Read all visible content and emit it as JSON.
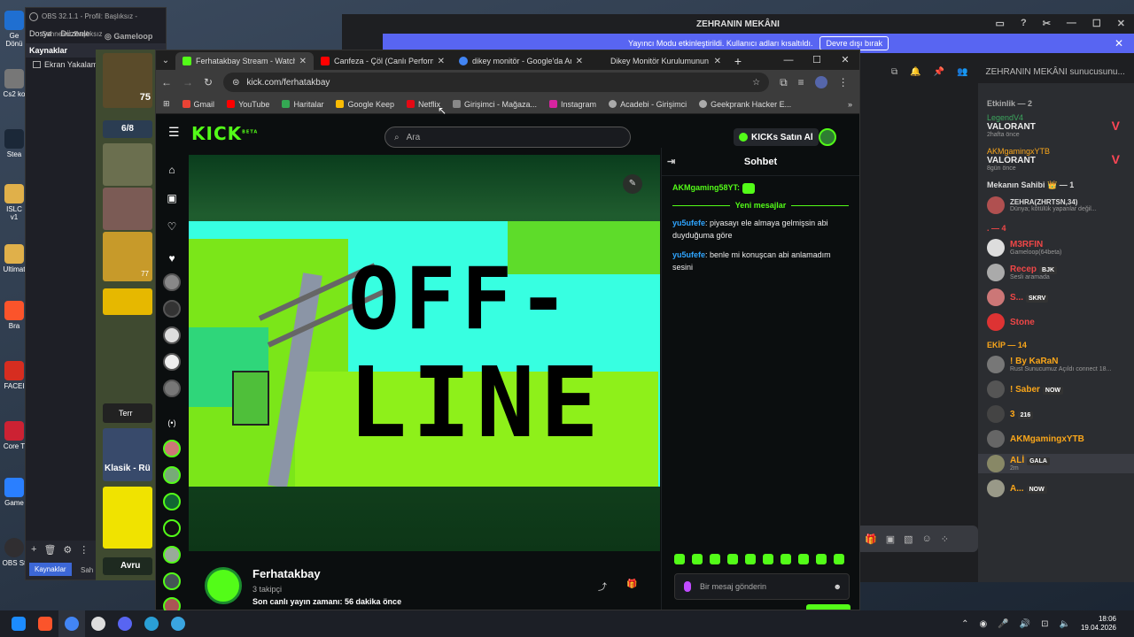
{
  "desktop": {
    "icons": [
      "Ge Dönü",
      "Cs2 ko",
      "Stea",
      "ISLC v1",
      "Ultimat",
      "Bra",
      "FACEI",
      "Core T",
      "Game",
      "OBS St"
    ]
  },
  "obs": {
    "title": "OBS 32.1.1 - Profil: Başlıksız - Sahneler: Başlıksız",
    "menu": [
      "Dosya",
      "Düzenle"
    ],
    "panel_title": "Kaynaklar",
    "source": "Ekran Yakalam",
    "tab_active": "Kaynaklar",
    "tab_other": "Sah"
  },
  "gameloop": {
    "label": "Gameloop"
  },
  "gamestrip": {
    "badge": "6/8",
    "level": "75",
    "card_num": "77",
    "terr": "Terr",
    "mode": "Klasik - Rü",
    "avru": "Avru"
  },
  "discord": {
    "server_title": "ZEHRANIN MEKÂNI",
    "banner_text": "Yayıncı Modu etkinleştirildi. Kullanıcı adları kısaltıldı.",
    "banner_button": "Devre dışı bırak",
    "search_placeholder": "ZEHRANIN MEKÂNI sunucusunu...",
    "activity_header": "Etkinlik — 2",
    "activities": [
      {
        "user": "LegendV4",
        "game": "VALORANT",
        "time": "2hafta önce"
      },
      {
        "user": "AKMgamingxYTB",
        "game": "VALORANT",
        "time": "8gün önce"
      }
    ],
    "owner_header": "Mekanın Sahibi 👑 — 1",
    "owner": {
      "name": "ZEHRA(ZHRTSN,34)",
      "status": "Dünya; kötülük yapanlar değil..."
    },
    "dot_header": ". — 4",
    "dot_members": [
      {
        "name": "M3RFIN",
        "status": "Gameloop(64beta)",
        "color": "#f04747"
      },
      {
        "name": "Recep",
        "badge": "BJK",
        "status": "Sesli aramada",
        "color": "#f04747"
      },
      {
        "name": "S...",
        "badge": "SKRV",
        "status": "",
        "color": "#f04747"
      },
      {
        "name": "Stone",
        "badge": "",
        "status": "",
        "color": "#f04747"
      }
    ],
    "team_header": "EKİP — 14",
    "team_members": [
      {
        "name": "! By KaRaN",
        "status": "Rust Sunucumuz Açıldı connect 18...",
        "badge": "",
        "color": "#faa61a"
      },
      {
        "name": "! Saber",
        "badge": "NOW",
        "status": "",
        "color": "#faa61a"
      },
      {
        "name": "3",
        "badge": "216",
        "status": "",
        "color": "#faa61a"
      },
      {
        "name": "AKMgamingxYTB",
        "badge": "",
        "status": "",
        "color": "#faa61a"
      },
      {
        "name": "ALİ",
        "badge": "GALA",
        "status": "2m",
        "color": "#faa61a"
      },
      {
        "name": "A...",
        "badge": "NOW",
        "status": "",
        "color": "#faa61a"
      }
    ]
  },
  "chrome": {
    "tabs": [
      {
        "label": "Ferhatakbay Stream - Watch L",
        "color": "#53fc18"
      },
      {
        "label": "Canfeza - Çöl (Canlı Performan",
        "color": "#ff0000"
      },
      {
        "label": "dikey monitör - Google'da Ara",
        "color": "#4285f4"
      },
      {
        "label": "Dikey Monitör Kurulumunun A",
        "color": "#888888"
      }
    ],
    "url": "kick.com/ferhatakbay",
    "bookmarks": [
      {
        "label": "Gmail",
        "color": "#ea4335"
      },
      {
        "label": "YouTube",
        "color": "#ff0000"
      },
      {
        "label": "Haritalar",
        "color": "#34a853"
      },
      {
        "label": "Google Keep",
        "color": "#fbbc04"
      },
      {
        "label": "Netflix",
        "color": "#e50914"
      },
      {
        "label": "Girişimci - Mağaza...",
        "color": "#888888"
      },
      {
        "label": "Instagram",
        "color": "#d6249f"
      },
      {
        "label": "Acadebi - Girişimci",
        "color": "#aaaaaa"
      },
      {
        "label": "Geekprank Hacker E...",
        "color": "#aaaaaa"
      }
    ]
  },
  "kick": {
    "logo": "KICK",
    "logo_beta": "BETA",
    "search_placeholder": "Ara",
    "buy_label": "KICKs Satın Al",
    "offline_line1": "OFF-",
    "offline_line2": "LINE",
    "channel_name": "Ferhatakbay",
    "followers": "3 takipçi",
    "last_live": "Son canlı yayın zamanı: 56 dakika önce",
    "chat_title": "Sohbet",
    "first_user": "AKMgaming58YT:",
    "new_messages": "Yeni mesajlar",
    "messages": [
      {
        "user": "yu5ufefe",
        "text": ": piyasayı ele almaya gelmişsin abi duyduğuma göre"
      },
      {
        "user": "yu5ufefe",
        "text": ": benle mi konuşcan abi anlamadım sesini"
      }
    ],
    "chat_placeholder": "Bir mesaj gönderin"
  },
  "taskbar": {
    "time": "18:06",
    "date": "19.04.2026"
  }
}
